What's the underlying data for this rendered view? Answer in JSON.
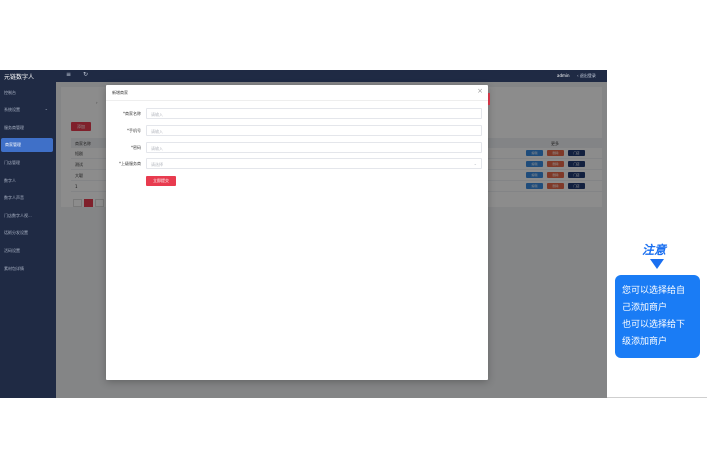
{
  "app": {
    "brand": "元链数字人",
    "user": "admin",
    "logout": "退出登录"
  },
  "sidebar": {
    "items": [
      {
        "label": "控制台"
      },
      {
        "label": "系统设置"
      },
      {
        "label": "服务商管理"
      },
      {
        "label": "商家管理"
      },
      {
        "label": "门店管理"
      },
      {
        "label": "数字人"
      },
      {
        "label": "数字人声音"
      },
      {
        "label": "门店数字人视..."
      },
      {
        "label": "话術分发设置"
      },
      {
        "label": "活码设置"
      },
      {
        "label": "素材包详情"
      }
    ]
  },
  "list": {
    "add_button": "添加",
    "columns": [
      "商家名称",
      "更多"
    ],
    "rows": [
      {
        "name": "短剧"
      },
      {
        "name": "测试"
      },
      {
        "name": "大聪"
      },
      {
        "name": "1"
      }
    ],
    "actions": {
      "edit": "编辑",
      "delete": "删除",
      "store": "门店"
    }
  },
  "modal": {
    "title": "新增商家",
    "close": "×",
    "fields": [
      {
        "label": "*商家名称",
        "placeholder": "请输入"
      },
      {
        "label": "*手机号",
        "placeholder": "请输入"
      },
      {
        "label": "*密码",
        "placeholder": "请输入"
      },
      {
        "label": "*上级服务商",
        "placeholder": "请选择"
      }
    ],
    "submit": "立即提交"
  },
  "annotation": {
    "title": "注意",
    "lines": [
      "您可以选择给自",
      "己添加商户",
      "也可以选择给下",
      "级添加商户"
    ]
  },
  "colors": {
    "accent_red": "#e83b4f",
    "sidebar_bg": "#1f2a44",
    "note_blue": "#1a7cf5"
  }
}
